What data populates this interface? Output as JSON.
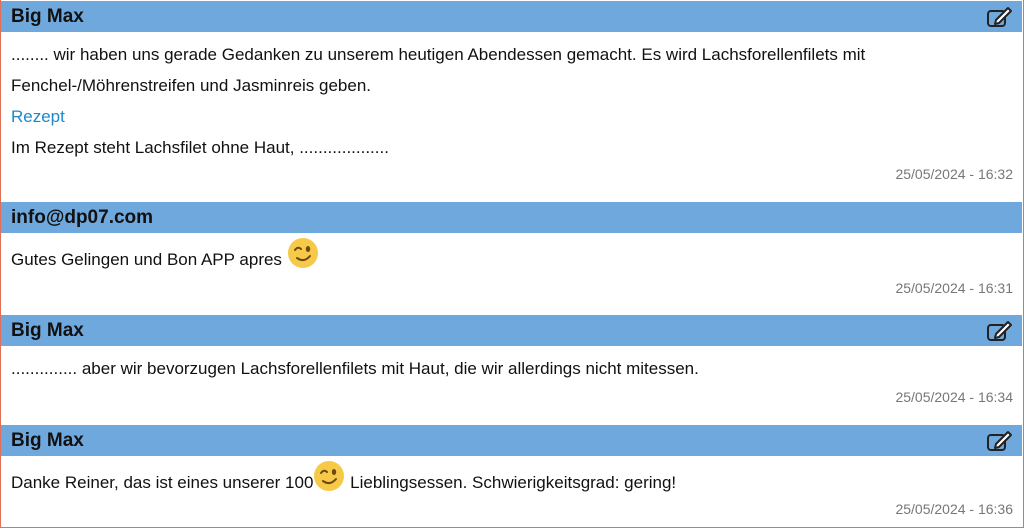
{
  "posts": [
    {
      "author": "Big Max",
      "editable": true,
      "lines": [
        "........ wir haben uns gerade Gedanken zu unserem heutigen Abendessen gemacht. Es wird Lachsforellenfilets mit",
        "Fenchel-/Möhrenstreifen und Jasminreis geben."
      ],
      "link_label": "Rezept",
      "after_link": "Im Rezept steht Lachsfilet ohne Haut, ...................",
      "timestamp": "25/05/2024 - 16:32"
    },
    {
      "author": "info@dp07.com",
      "editable": false,
      "text": "Gutes Gelingen und Bon APP apres",
      "emoji": "wink-emoji",
      "timestamp": "25/05/2024 - 16:31"
    },
    {
      "author": "Big Max",
      "editable": true,
      "text": ".............. aber wir bevorzugen Lachsforellenfilets mit Haut, die wir allerdings nicht mitessen.",
      "timestamp": "25/05/2024 - 16:34"
    },
    {
      "author": "Big Max",
      "editable": true,
      "text_before": "Danke Reiner, das ist eines unserer 100",
      "emoji": "wink-emoji",
      "text_after": " Lieblingsessen. Schwierigkeitsgrad: gering!",
      "timestamp": "25/05/2024 - 16:36"
    }
  ],
  "colors": {
    "header_bg": "#6fa8dc",
    "link": "#1e88c8",
    "frame_border": "#e0705a"
  }
}
